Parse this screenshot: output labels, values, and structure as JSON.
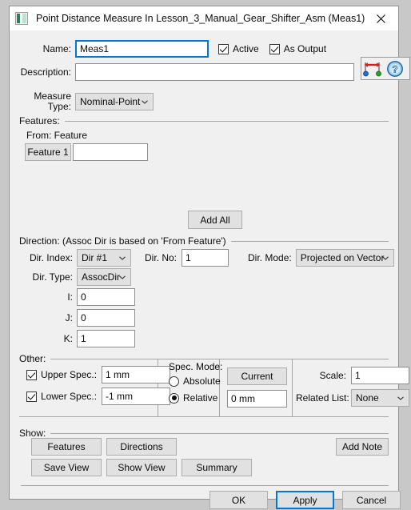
{
  "window": {
    "title": "Point Distance Measure In Lesson_3_Manual_Gear_Shifter_Asm (Meas1)",
    "close_label": "✕"
  },
  "form": {
    "name_label": "Name:",
    "name_value": "Meas1",
    "name_placeholder": "",
    "active_label": "Active",
    "active_checked": "true",
    "as_output_label": "As Output",
    "as_output_checked": "true",
    "description_label": "Description:",
    "description_value": "",
    "description_placeholder": "",
    "measure_type_label_line1": "Measure",
    "measure_type_label_line2": "Type:",
    "measure_type_value": "Nominal-Point"
  },
  "toolbar": {
    "distance_icon_name": "point-distance-icon",
    "help_icon_name": "help-icon"
  },
  "features": {
    "group_label": "Features:",
    "from_label": "From: Feature",
    "feature_button_label": "Feature 1",
    "feature_value": "",
    "add_all_label": "Add All"
  },
  "direction": {
    "group_label": "Direction: (Assoc Dir is based on 'From Feature')",
    "dir_index_label": "Dir. Index:",
    "dir_index_value": "Dir #1",
    "dir_no_label": "Dir. No:",
    "dir_no_value": "1",
    "dir_mode_label": "Dir. Mode:",
    "dir_mode_value": "Projected on Vector",
    "dir_type_label": "Dir. Type:",
    "dir_type_value": "AssocDir",
    "i_label": "I:",
    "i_value": "0",
    "j_label": "J:",
    "j_value": "0",
    "k_label": "K:",
    "k_value": "1"
  },
  "other": {
    "group_label": "Other:",
    "upper_spec_label": "Upper Spec.:",
    "upper_spec_checked": "true",
    "upper_spec_value": "1 mm",
    "lower_spec_label": "Lower Spec.:",
    "lower_spec_checked": "true",
    "lower_spec_value": "-1 mm",
    "spec_mode_label": "Spec. Mode:",
    "absolute_label": "Absolute",
    "relative_label": "Relative",
    "spec_mode_selected": "Relative",
    "current_label": "Current",
    "current_value": "0 mm",
    "scale_label": "Scale:",
    "scale_value": "1",
    "related_list_label": "Related List:",
    "related_list_value": "None"
  },
  "show": {
    "group_label": "Show:",
    "features_label": "Features",
    "directions_label": "Directions",
    "add_note_label": "Add Note",
    "save_view_label": "Save View",
    "show_view_label": "Show View",
    "summary_label": "Summary"
  },
  "footer": {
    "ok_label": "OK",
    "apply_label": "Apply",
    "cancel_label": "Cancel",
    "default_button": "Apply"
  },
  "colors": {
    "accent": "#0078d7",
    "dialog_bg": "#f0f0f0",
    "field_bg": "#ffffff",
    "button_bg": "#e1e1e1",
    "separator": "#a6a6a6"
  }
}
